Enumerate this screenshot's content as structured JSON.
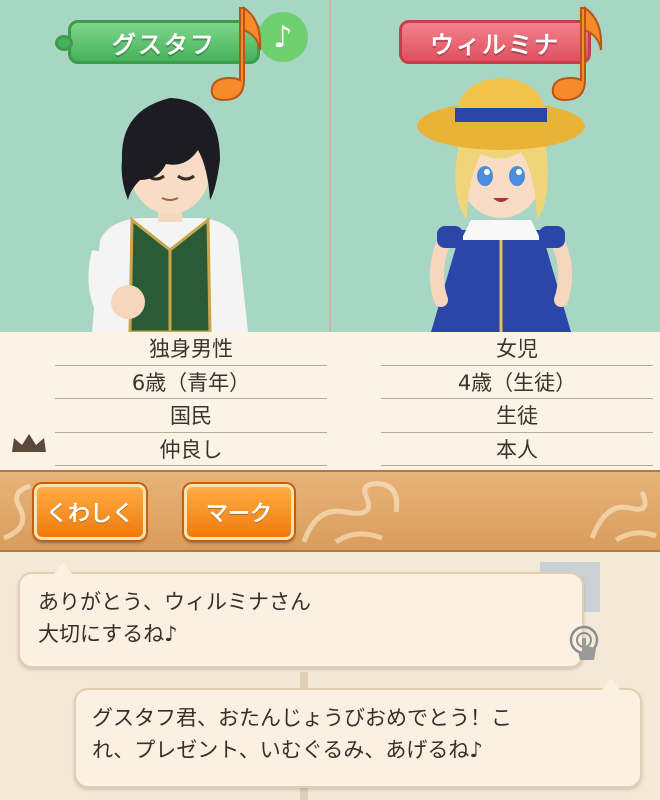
{
  "characters": {
    "left": {
      "name": "グスタフ",
      "tag_color": "#4cb860",
      "status": "♪",
      "info": [
        "独身男性",
        "6歳（青年）",
        "国民",
        "仲良し"
      ]
    },
    "right": {
      "name": "ウィルミナ",
      "tag_color": "#e2525f",
      "info": [
        "女児",
        "4歳（生徒）",
        "生徒",
        "本人"
      ]
    }
  },
  "buttons": {
    "details_label": "くわしく",
    "mark_label": "マーク"
  },
  "dialogue": {
    "reply_line1": "ありがとう、ウィルミナさん",
    "reply_line2": "大切にするね♪",
    "speech_line1": "グスタフ君、おたんじょうびおめでとう！こ",
    "speech_line2": "れ、プレゼント、いむぐるみ、あげるね♪"
  },
  "icons": {
    "music_note": "music-note-icon",
    "crown": "crown-icon",
    "touch": "touch-hand-icon"
  }
}
